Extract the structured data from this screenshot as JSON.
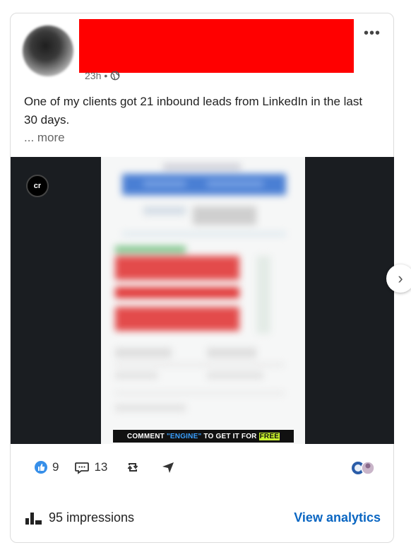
{
  "post": {
    "timestamp": "23h",
    "timestamp_separator": "•",
    "more_menu": "•••",
    "text": "One of my clients got 21 inbound leads from LinkedIn in the last 30 days.",
    "see_more": "... more"
  },
  "media": {
    "logo_badge": "cr",
    "caption": {
      "part1": "COMMENT",
      "part2": "\"ENGINE\"",
      "part3": "TO GET IT FOR",
      "part4": "FREE"
    },
    "next_arrow": "›"
  },
  "social": {
    "likes": "9",
    "comments": "13"
  },
  "footer": {
    "impressions": "95 impressions",
    "view_analytics": "View analytics"
  },
  "colors": {
    "link": "#0a66c2",
    "like_blue": "#378fe9",
    "redaction": "#ff0000"
  }
}
